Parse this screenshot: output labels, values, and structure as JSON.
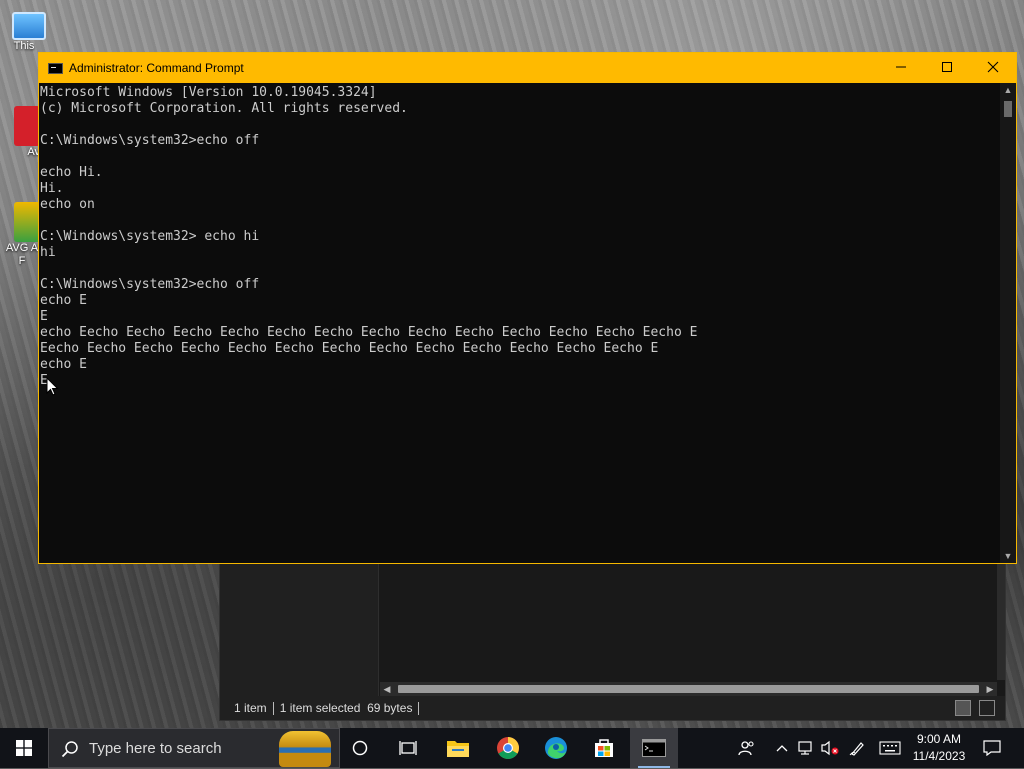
{
  "desktop": {
    "icons": [
      {
        "label": "This",
        "name": "this-pc"
      },
      {
        "label": "Av",
        "name": "acrobat"
      },
      {
        "label": "AVG A F",
        "name": "avg"
      }
    ]
  },
  "cmd_window": {
    "title": "Administrator: Command Prompt",
    "lines": [
      "Microsoft Windows [Version 10.0.19045.3324]",
      "(c) Microsoft Corporation. All rights reserved.",
      "",
      "C:\\Windows\\system32>echo off",
      "",
      "echo Hi.",
      "Hi.",
      "echo on",
      "",
      "C:\\Windows\\system32> echo hi",
      "hi",
      "",
      "C:\\Windows\\system32>echo off",
      "echo E",
      "E",
      "echo Eecho Eecho Eecho Eecho Eecho Eecho Eecho Eecho Eecho Eecho Eecho Eecho Eecho E",
      "Eecho Eecho Eecho Eecho Eecho Eecho Eecho Eecho Eecho Eecho Eecho Eecho Eecho E",
      "echo E",
      "E"
    ]
  },
  "explorer": {
    "status_items": "1 item",
    "status_selected": "1 item selected",
    "status_size": "69 bytes"
  },
  "taskbar": {
    "search_placeholder": "Type here to search",
    "time": "9:00 AM",
    "date": "11/4/2023",
    "apps": [
      "cortana",
      "task-view",
      "file-explorer",
      "chrome",
      "edge",
      "microsoft-store",
      "command-prompt"
    ]
  },
  "colors": {
    "titlebar_accent": "#ffba00",
    "console_bg": "#0c0c0c",
    "console_fg": "#cccccc",
    "taskbar_bg": "#111318"
  }
}
